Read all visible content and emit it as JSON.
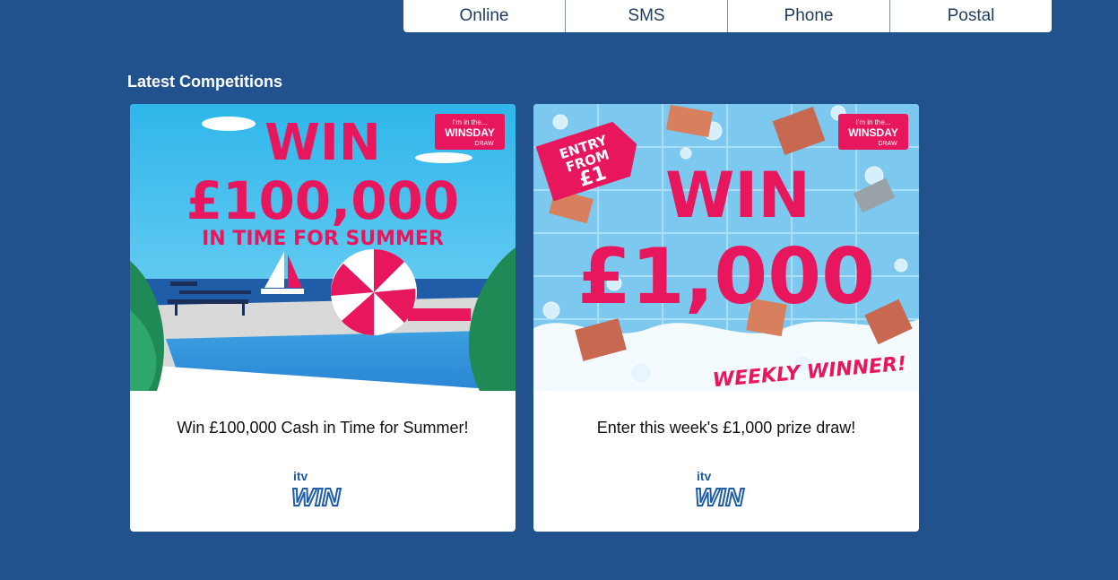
{
  "tabs": [
    {
      "label": "Online"
    },
    {
      "label": "SMS"
    },
    {
      "label": "Phone"
    },
    {
      "label": "Postal"
    }
  ],
  "section_title": "Latest Competitions",
  "cards": [
    {
      "title": "Win £100,000 Cash in Time for Summer!",
      "image_headline": "WIN",
      "image_amount": "£100,000",
      "image_tagline": "IN TIME FOR SUMMER",
      "badge_small": "I'm in the...",
      "badge_main": "WINSDAY",
      "badge_sub": "DRAW",
      "logo_top": "itv",
      "logo_main": "WIN"
    },
    {
      "title": "Enter this week's £1,000 prize draw!",
      "image_headline": "WIN",
      "image_amount": "£1,000",
      "image_tag_line1": "ENTRY",
      "image_tag_line2": "FROM",
      "image_tag_line3": "£1",
      "image_tagline": "WEEKLY WINNER!",
      "badge_small": "I'm in the...",
      "badge_main": "WINSDAY",
      "badge_sub": "DRAW",
      "logo_top": "itv",
      "logo_main": "WIN"
    }
  ]
}
